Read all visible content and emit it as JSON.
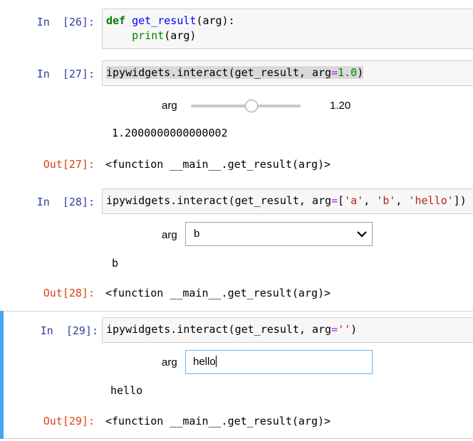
{
  "cell26": {
    "prompt": "In  [26]:",
    "line1": {
      "kw": "def",
      "sp": " ",
      "fn": "get_result",
      "rest": "(arg):"
    },
    "line2": {
      "indent": "    ",
      "bi": "print",
      "rest": "(arg)"
    }
  },
  "cell27": {
    "prompt": "In  [27]:",
    "code": {
      "a": "ipywidgets.interact(get_result, arg",
      "op": "=",
      "num": "1.0",
      "close": ")"
    },
    "widget_label": "arg",
    "slider_readout": "1.20",
    "slider_value": 1.2,
    "slider_min": -1.0,
    "slider_max": 3.0,
    "printed": "1.2000000000000002",
    "out_prompt": "Out[27]:",
    "out_value": "<function __main__.get_result(arg)>"
  },
  "cell28": {
    "prompt": "In  [28]:",
    "code": {
      "a": "ipywidgets.interact(get_result, arg",
      "op": "=",
      "open": "[",
      "s1": "'a'",
      "c1": ", ",
      "s2": "'b'",
      "c2": ", ",
      "s3": "'hello'",
      "close": "])"
    },
    "widget_label": "arg",
    "dropdown_value": "b",
    "printed": "b",
    "out_prompt": "Out[28]:",
    "out_value": "<function __main__.get_result(arg)>"
  },
  "cell29": {
    "prompt": "In  [29]:",
    "code": {
      "a": "ipywidgets.interact(get_result, arg",
      "op": "=",
      "str": "''",
      "close": ")"
    },
    "widget_label": "arg",
    "text_value": "hello",
    "printed": "hello",
    "out_prompt": "Out[29]:",
    "out_value": "<function __main__.get_result(arg)>"
  },
  "colors": {
    "in_prompt": "#303f9f",
    "out_prompt": "#d84315",
    "selection_bar": "#42a5f5"
  }
}
